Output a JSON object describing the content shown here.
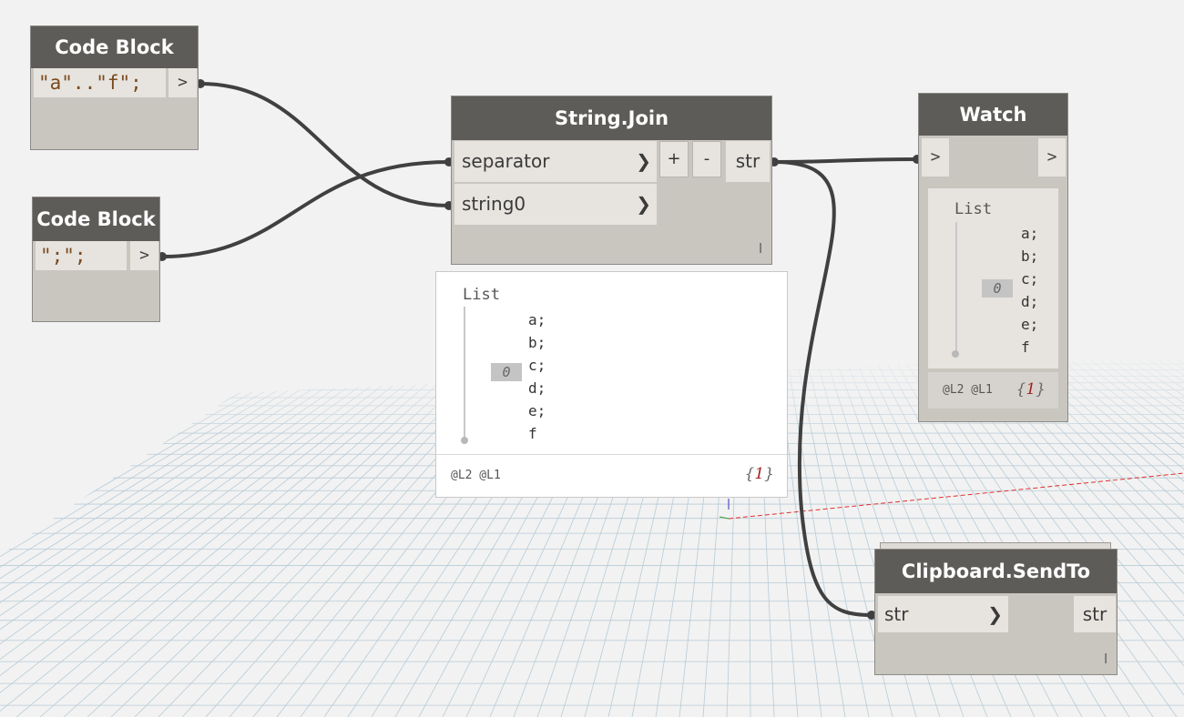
{
  "code_block_1": {
    "title": "Code Block",
    "code": "\"a\"..\"f\";",
    "output": ">"
  },
  "code_block_2": {
    "title": "Code Block",
    "code": "\";\";",
    "output": ">"
  },
  "string_join": {
    "title": "String.Join",
    "inputs": [
      "separator",
      "string0"
    ],
    "add_label": "+",
    "remove_label": "-",
    "output": "str",
    "lacing": "l"
  },
  "watch": {
    "title": "Watch",
    "input": ">",
    "output": ">",
    "preview": {
      "label": "List",
      "index": "0",
      "items": [
        "a;",
        "b;",
        "c;",
        "d;",
        "e;",
        "f"
      ],
      "levels": "@L2 @L1",
      "count": "1"
    }
  },
  "string_join_preview": {
    "label": "List",
    "index": "0",
    "items": [
      "a;",
      "b;",
      "c;",
      "d;",
      "e;",
      "f"
    ],
    "levels": "@L2 @L1",
    "count": "1"
  },
  "clipboard": {
    "title": "Clipboard.SendTo",
    "input": "str",
    "output": "str",
    "lacing": "l"
  },
  "brace_open": "{",
  "brace_close": "}",
  "colors": {
    "node_header": "#5e5c58",
    "node_body": "#c9c5bf",
    "port_bg": "#e7e4df",
    "wire": "#404040",
    "canvas": "#f2f2f2"
  }
}
